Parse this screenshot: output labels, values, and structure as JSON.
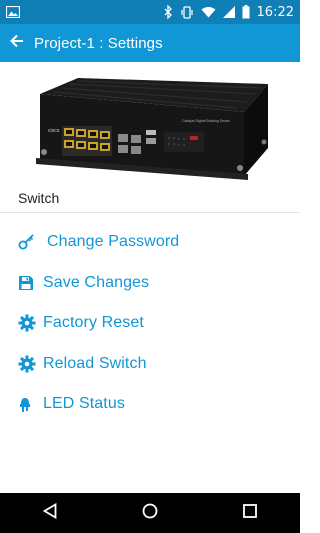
{
  "status_bar": {
    "time": "16:22",
    "icons": [
      "image-icon",
      "bluetooth-icon",
      "vibrate-icon",
      "wifi-icon",
      "signal-icon",
      "battery-icon"
    ]
  },
  "app_bar": {
    "title": "Project-1 : Settings",
    "back_icon": "arrow-back-icon"
  },
  "device": {
    "label": "Switch",
    "image_description_icon": "network-switch-image"
  },
  "menu": {
    "items": [
      {
        "label": "Change Password",
        "icon": "key-icon"
      },
      {
        "label": "Save Changes",
        "icon": "save-icon"
      },
      {
        "label": "Factory Reset",
        "icon": "gear-icon"
      },
      {
        "label": "Reload Switch",
        "icon": "gear-icon"
      },
      {
        "label": "LED Status",
        "icon": "lightbulb-icon"
      }
    ]
  },
  "colors": {
    "accent": "#1197d6",
    "status_bar": "#0f7fb5",
    "nav_bar": "#000000"
  },
  "nav_bar": {
    "icons": [
      "back-triangle-icon",
      "home-circle-icon",
      "recents-square-icon"
    ]
  }
}
